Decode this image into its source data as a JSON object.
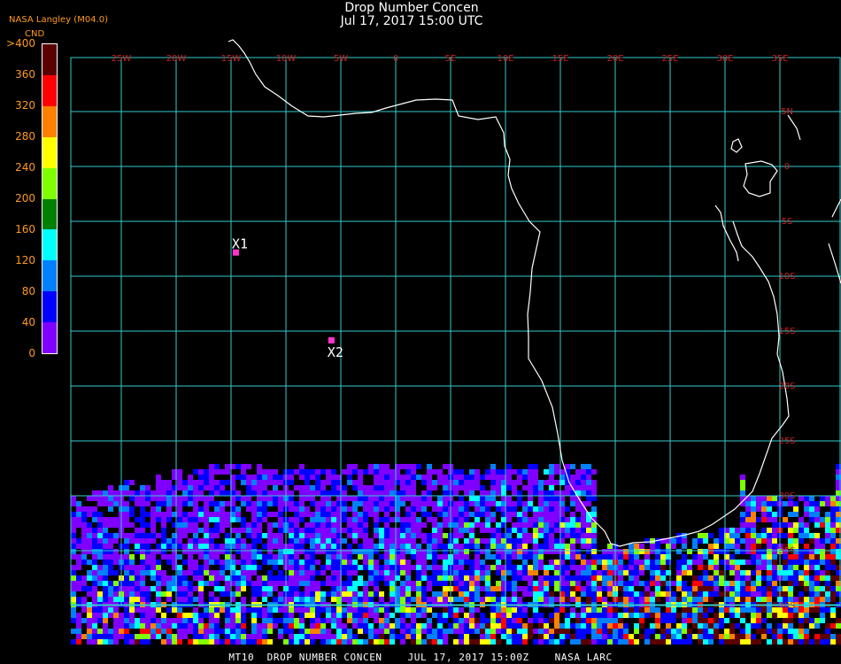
{
  "header": {
    "title_line1": "Drop Number Concen",
    "title_line2": "Jul 17, 2017 15:00 UTC",
    "organization": "NASA Langley (M04.0)"
  },
  "colorbar": {
    "unit": "CND",
    "tick_labels": [
      ">400",
      "360",
      "320",
      "280",
      "240",
      "200",
      "160",
      "120",
      "80",
      "40",
      "0"
    ],
    "colors_top_to_bottom": [
      "#5a0000",
      "#ff0000",
      "#ff8000",
      "#ffff00",
      "#80ff00",
      "#008000",
      "#00ffff",
      "#0080ff",
      "#0000ff",
      "#8000ff"
    ]
  },
  "map": {
    "lon_labels": [
      "25W",
      "20W",
      "15W",
      "10W",
      "5W",
      "0",
      "5E",
      "10E",
      "15E",
      "20E",
      "25E",
      "30E",
      "35E"
    ],
    "lat_labels": [
      "5N",
      "0",
      "5S",
      "10S",
      "15S",
      "20S",
      "25S",
      "30S",
      "35S",
      "40S"
    ],
    "grid_color": "#33cccc",
    "label_color": "#cc2222",
    "coast_color": "#ffffff",
    "markers": [
      {
        "label": "X1",
        "lon": -14.6,
        "lat": -7.8,
        "color": "#ff33cc"
      },
      {
        "label": "X2",
        "lon": -5.9,
        "lat": -15.8,
        "color": "#ff33cc"
      }
    ]
  },
  "footer": {
    "text": "MT10  DROP NUMBER CONCEN    JUL 17, 2017 15:00Z    NASA LARC"
  }
}
